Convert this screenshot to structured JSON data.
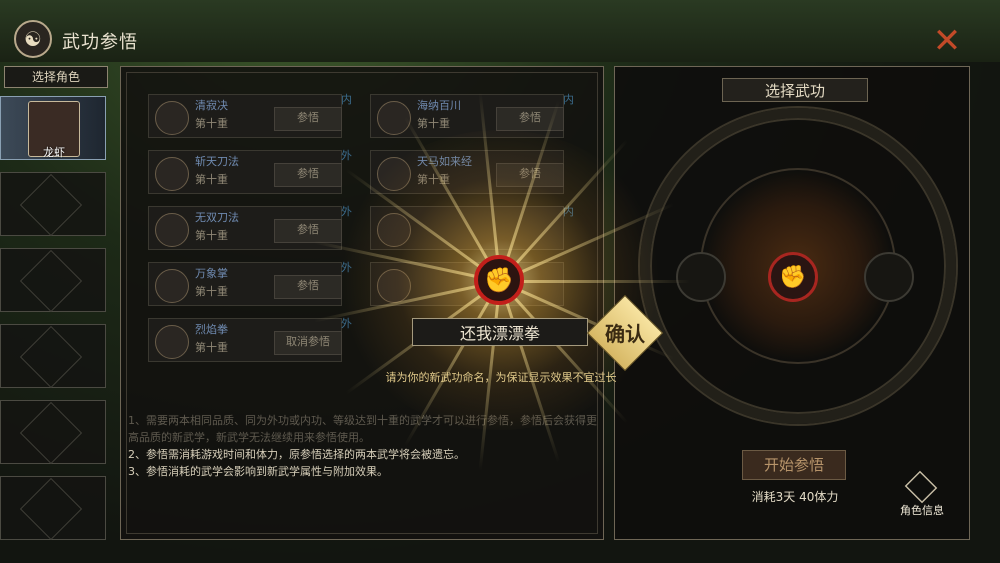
{
  "header": {
    "title": "武功参悟",
    "emblem_icon": "emblem-icon",
    "close_icon": "close-x-icon"
  },
  "roles": {
    "select_label": "选择角色",
    "selected": {
      "name": "龙虾"
    },
    "empty_slots": 5
  },
  "skills": [
    {
      "name": "清寂决",
      "level": "第十重",
      "action": "参悟",
      "tag": "内"
    },
    {
      "name": "海纳百川",
      "level": "第十重",
      "action": "参悟",
      "tag": "内"
    },
    {
      "name": "斩天刀法",
      "level": "第十重",
      "action": "参悟",
      "tag": "外"
    },
    {
      "name": "天马如来经",
      "level": "第十重",
      "action": "参悟",
      "tag": ""
    },
    {
      "name": "无双刀法",
      "level": "第十重",
      "action": "参悟",
      "tag": "外"
    },
    {
      "name": "",
      "level": "",
      "action": "",
      "tag": "内"
    },
    {
      "name": "万象掌",
      "level": "第十重",
      "action": "参悟",
      "tag": "外"
    },
    {
      "name": "",
      "level": "",
      "action": "",
      "tag": ""
    },
    {
      "name": "烈焰拳",
      "level": "第十重",
      "action": "取消参悟",
      "tag": "外"
    }
  ],
  "notes": [
    "1、需要两本相同品质、同为外功或内功、等级达到十重的武学才可以进行参悟，参悟后会获得更高品质的新武学，新武学无法继续用来参悟使用。",
    "2、参悟需消耗游戏时间和体力，原参悟选择的两本武学将会被遗忘。",
    "3、参悟消耗的武学会影响到新武学属性与附加效果。"
  ],
  "right_panel": {
    "title": "选择武功",
    "start_button": "开始参悟",
    "cost": "消耗3天 40体力",
    "role_info": "角色信息"
  },
  "dialog": {
    "name_value": "还我漂漂拳",
    "confirm_label": "确认",
    "hint": "请为你的新武功命名，为保证显示效果不宜过长"
  },
  "colors": {
    "accent_red": "#c21f1a",
    "gold": "#e0c98a",
    "close": "#c24a28"
  }
}
